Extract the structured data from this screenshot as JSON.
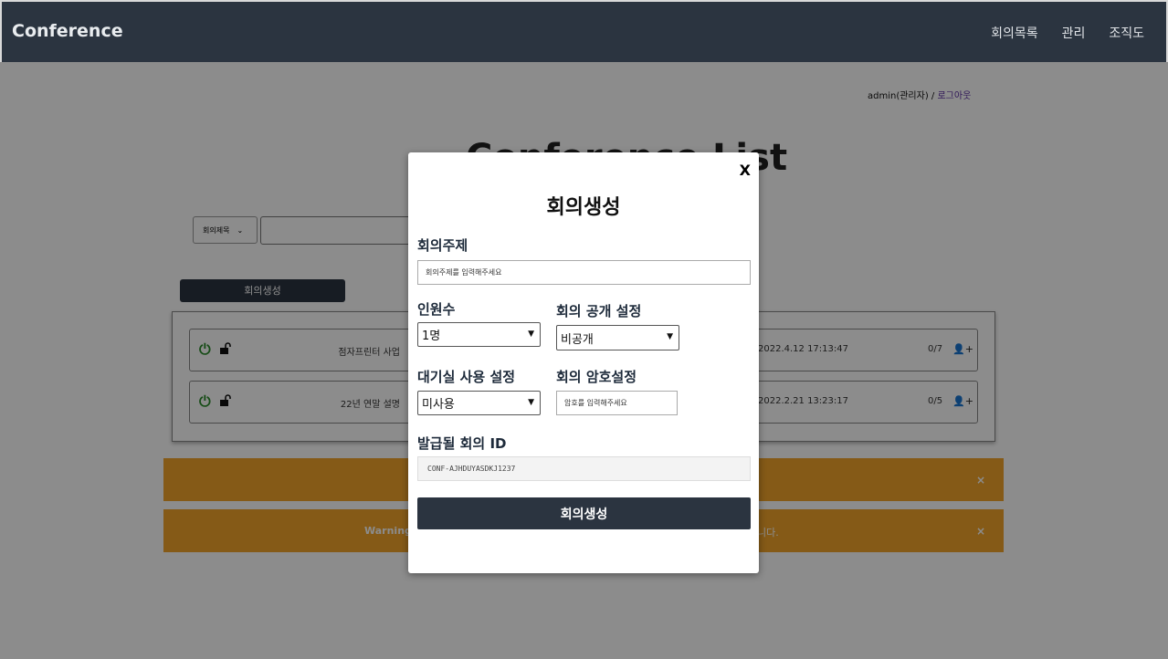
{
  "app": {
    "brand": "Conference"
  },
  "nav": {
    "items": [
      "회의목록",
      "관리",
      "조직도"
    ]
  },
  "user": {
    "name": "admin(관리자) / ",
    "logout": "로그아웃"
  },
  "page": {
    "title": "Conference List",
    "search_option": "회의제목",
    "create_button": "회의생성"
  },
  "conferences": [
    {
      "title": "점자프린터 사업",
      "date": "2022.4.12 17:13:47",
      "count": "0/7"
    },
    {
      "title": "22년 연말 설명",
      "date": "2022.2.21 13:23:17",
      "count": "0/5"
    }
  ],
  "alerts": [
    {
      "msg": "",
      "msg2": ""
    },
    {
      "msg": "Warning",
      "msg2": "니다."
    }
  ],
  "modal": {
    "close": "X",
    "title": "회의생성",
    "topic_label": "회의주제",
    "topic_placeholder": "회의주제를 입력해주세요",
    "people_label": "인원수",
    "people_value": "1명",
    "public_label": "회의 공개 설정",
    "public_value": "비공개",
    "waiting_label": "대기실 사용 설정",
    "waiting_value": "미사용",
    "password_label": "회의 암호설정",
    "password_placeholder": "암호를 입력해주세요",
    "id_label": "발급될 회의 ID",
    "id_value": "CONF-AJHDUYASDKJ1237",
    "submit": "회의생성"
  },
  "colors": {
    "navbar": "#2b3440",
    "alert": "#f2a52a",
    "power": "#2c8c2c"
  }
}
